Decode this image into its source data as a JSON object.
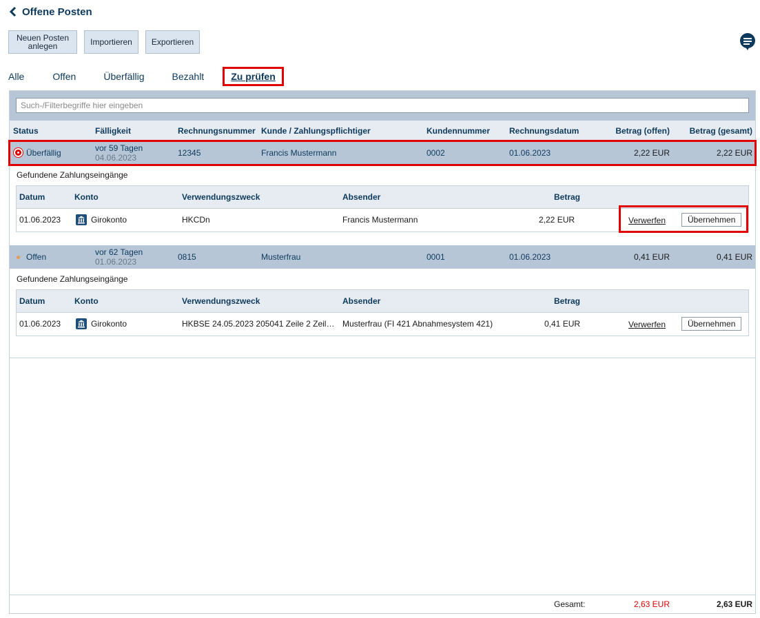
{
  "header": {
    "title": "Offene Posten",
    "back_icon": "chevron-left-icon"
  },
  "toolbar": {
    "new_label": "Neuen Posten\nanlegen",
    "import_label": "Importieren",
    "export_label": "Exportieren",
    "chat_icon": "chat-bubble-icon"
  },
  "tabs": [
    {
      "label": "Alle"
    },
    {
      "label": "Offen"
    },
    {
      "label": "Überfällig"
    },
    {
      "label": "Bezahlt"
    },
    {
      "label": "Zu prüfen",
      "active": true
    }
  ],
  "filter": {
    "placeholder": "Such-/Filterbegriffe hier eingeben"
  },
  "columns": {
    "status": "Status",
    "due": "Fälligkeit",
    "invoice_no": "Rechnungsnummer",
    "customer": "Kunde / Zahlungspflichtiger",
    "customer_no": "Kundennummer",
    "invoice_date": "Rechnungsdatum",
    "amount_open": "Betrag (offen)",
    "amount_total": "Betrag (gesamt)"
  },
  "items": [
    {
      "status": "Überfällig",
      "status_color": "#e00000",
      "due_relative": "vor 59 Tagen",
      "due_date": "04.06.2023",
      "invoice_no": "12345",
      "customer": "Francis Mustermann",
      "customer_no": "0002",
      "invoice_date": "01.06.2023",
      "amount_open": "2,22 EUR",
      "amount_total": "2,22 EUR",
      "found_label": "Gefundene Zahlungseingänge",
      "payment_columns": {
        "date": "Datum",
        "account": "Konto",
        "purpose": "Verwendungszweck",
        "sender": "Absender",
        "amount": "Betrag"
      },
      "payment": {
        "date": "01.06.2023",
        "account": "Girokonto",
        "purpose": "HKCDn",
        "sender": "Francis Mustermann",
        "amount": "2,22 EUR",
        "discard": "Verwerfen",
        "accept": "Übernehmen"
      }
    },
    {
      "status": "Offen",
      "status_color": "#e79a5a",
      "due_relative": "vor 62 Tagen",
      "due_date": "01.06.2023",
      "invoice_no": "0815",
      "customer": "Musterfrau",
      "customer_no": "0001",
      "invoice_date": "01.06.2023",
      "amount_open": "0,41 EUR",
      "amount_total": "0,41 EUR",
      "found_label": "Gefundene Zahlungseingänge",
      "payment_columns": {
        "date": "Datum",
        "account": "Konto",
        "purpose": "Verwendungszweck",
        "sender": "Absender",
        "amount": "Betrag"
      },
      "payment": {
        "date": "01.06.2023",
        "account": "Girokonto",
        "purpose": "HKBSE 24.05.2023 205041 Zeile 2 Zeil…",
        "sender": "Musterfrau (FI 421 Abnahmesystem 421)",
        "amount": "0,41 EUR",
        "discard": "Verwerfen",
        "accept": "Übernehmen"
      }
    }
  ],
  "footer": {
    "label": "Gesamt:",
    "total_open": "2,63 EUR",
    "total_open_color": "#e00000",
    "total_all": "2,63 EUR"
  },
  "colors": {
    "accent": "#0d3a5c",
    "highlight": "#e00000",
    "row_bg": "#b6c6d7",
    "header_bg": "#e6ecf2"
  }
}
